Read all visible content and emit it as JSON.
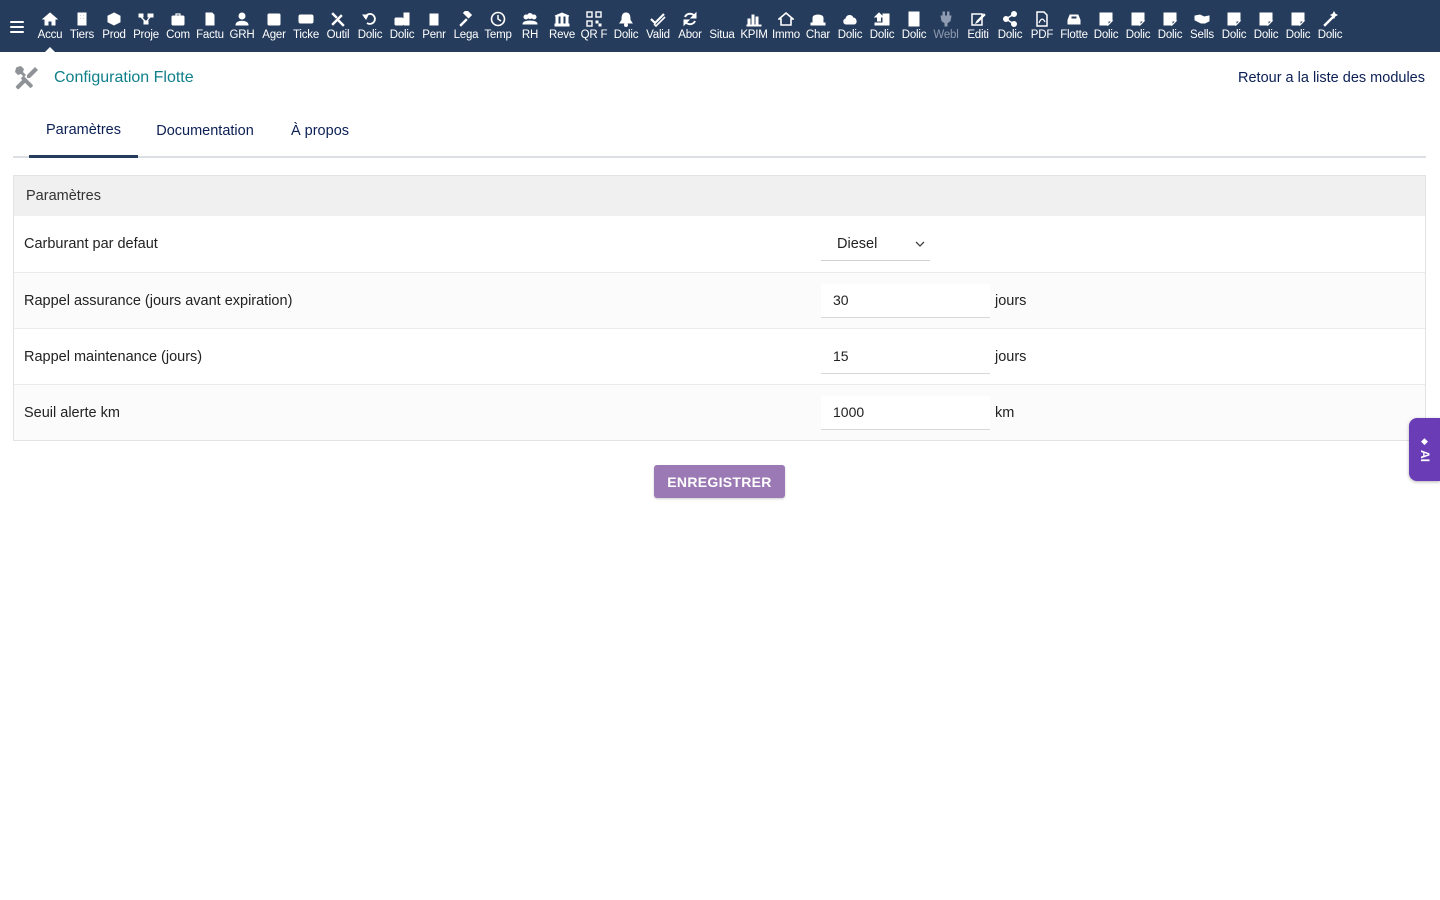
{
  "topbar": {
    "menu": [
      {
        "label": "Accu",
        "icon": "home-icon"
      },
      {
        "label": "Tiers",
        "icon": "building-icon"
      },
      {
        "label": "Prod",
        "icon": "cube-icon"
      },
      {
        "label": "Proje",
        "icon": "project-icon"
      },
      {
        "label": "Com",
        "icon": "briefcase-icon"
      },
      {
        "label": "Factu",
        "icon": "invoice-icon"
      },
      {
        "label": "GRH",
        "icon": "user-icon"
      },
      {
        "label": "Ager",
        "icon": "calendar-icon"
      },
      {
        "label": "Ticke",
        "icon": "ticket-icon"
      },
      {
        "label": "Outil",
        "icon": "tools-icon"
      },
      {
        "label": "Dolic",
        "icon": "undo-icon"
      },
      {
        "label": "Dolic",
        "icon": "briefcase-doc-icon"
      },
      {
        "label": "Penr",
        "icon": "document-icon"
      },
      {
        "label": "Lega",
        "icon": "gavel-icon"
      },
      {
        "label": "Temp",
        "icon": "clock-icon"
      },
      {
        "label": "RH",
        "icon": "users-icon"
      },
      {
        "label": "Reve",
        "icon": "bank-icon"
      },
      {
        "label": "QR F",
        "icon": "qrcode-icon"
      },
      {
        "label": "Dolic",
        "icon": "bell-icon"
      },
      {
        "label": "Valid",
        "icon": "check-double-icon"
      },
      {
        "label": "Abor",
        "icon": "refresh-icon"
      },
      {
        "label": "Situa",
        "icon": "blank-icon"
      },
      {
        "label": "KPIM",
        "icon": "bar-chart-icon"
      },
      {
        "label": "Immo",
        "icon": "house-icon"
      },
      {
        "label": "Char",
        "icon": "hat-icon"
      },
      {
        "label": "Dolic",
        "icon": "cloud-icon"
      },
      {
        "label": "Dolic",
        "icon": "upload-icon"
      },
      {
        "label": "Dolic",
        "icon": "office-building-icon"
      },
      {
        "label": "Webl",
        "icon": "plug-icon",
        "disabled": true
      },
      {
        "label": "Editi",
        "icon": "edit-icon"
      },
      {
        "label": "Dolic",
        "icon": "share-icon"
      },
      {
        "label": "PDF",
        "icon": "pdf-icon"
      },
      {
        "label": "Flotte",
        "icon": "car-icon"
      },
      {
        "label": "Dolic",
        "icon": "note-icon"
      },
      {
        "label": "Dolic",
        "icon": "note-icon"
      },
      {
        "label": "Dolic",
        "icon": "note-icon"
      },
      {
        "label": "Sells",
        "icon": "handshake-icon"
      },
      {
        "label": "Dolic",
        "icon": "note-icon"
      },
      {
        "label": "Dolic",
        "icon": "note-icon"
      },
      {
        "label": "Dolic",
        "icon": "note-icon"
      },
      {
        "label": "Dolic",
        "icon": "magic-icon"
      }
    ]
  },
  "header": {
    "title": "Configuration Flotte",
    "back_link": "Retour a la liste des modules"
  },
  "tabs": {
    "parametres": "Paramètres",
    "documentation": "Documentation",
    "apropos": "À propos"
  },
  "panel": {
    "title": "Paramètres",
    "rows": {
      "fuel": {
        "label": "Carburant par defaut",
        "value": "Diesel"
      },
      "insurance": {
        "label": "Rappel assurance (jours avant expiration)",
        "value": "30",
        "unit": "jours"
      },
      "maintenance": {
        "label": "Rappel maintenance (jours)",
        "value": "15",
        "unit": "jours"
      },
      "km": {
        "label": "Seuil alerte km",
        "value": "1000",
        "unit": "km"
      }
    }
  },
  "save_button": "ENREGISTRER",
  "ai_tab": {
    "label": "AI"
  },
  "colors": {
    "topbar": "#263c5c",
    "title": "#0f7f8a",
    "save_button": "#9b79b5",
    "ai_tab": "#6a3db6"
  }
}
